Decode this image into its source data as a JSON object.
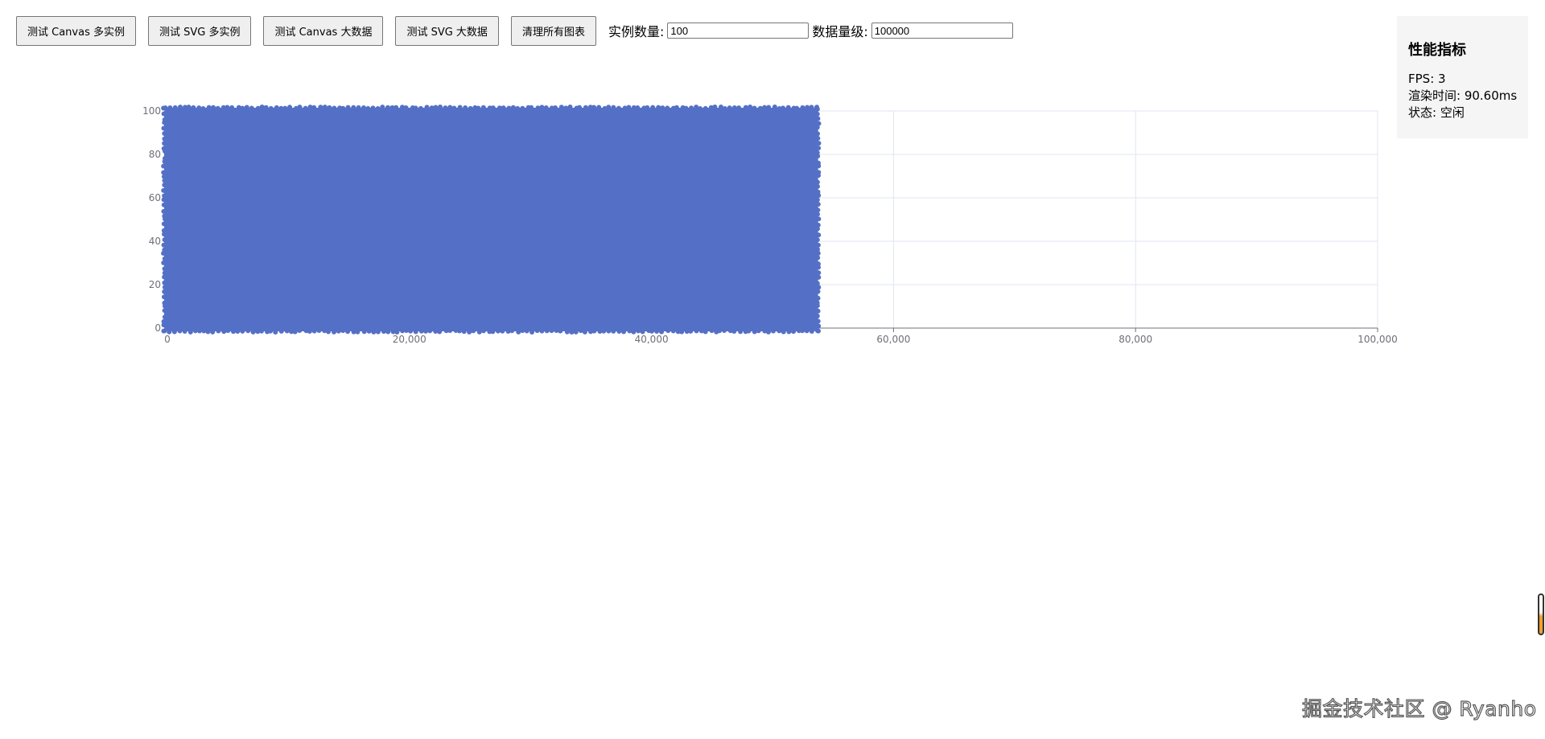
{
  "toolbar": {
    "buttons": [
      {
        "label": "测试 Canvas 多实例"
      },
      {
        "label": "测试 SVG 多实例"
      },
      {
        "label": "测试 Canvas 大数据"
      },
      {
        "label": "测试 SVG 大数据"
      },
      {
        "label": "清理所有图表"
      }
    ],
    "instance_count_label": "实例数量:",
    "instance_count_value": "100",
    "data_size_label": "数据量级:",
    "data_size_value": "100000"
  },
  "metrics": {
    "title": "性能指标",
    "fps": "FPS: 3",
    "render_time": "渲染时间: 90.60ms",
    "status": "状态: 空闲"
  },
  "chart_data": {
    "type": "scatter",
    "title": "",
    "xlabel": "",
    "ylabel": "",
    "xlim": [
      0,
      100000
    ],
    "ylim": [
      0,
      100
    ],
    "x_ticks": [
      "0",
      "20,000",
      "40,000",
      "60,000",
      "80,000",
      "100,000"
    ],
    "y_ticks": [
      "0",
      "20",
      "40",
      "60",
      "80",
      "100"
    ],
    "grid": true,
    "series": [
      {
        "color": "#5470c6",
        "dense_region": {
          "x": [
            0,
            53500
          ],
          "y": [
            0,
            100
          ]
        }
      }
    ]
  },
  "watermark": "掘金技术社区 @ Ryanho",
  "colors": {
    "accent": "#5470c6",
    "panel_bg": "#f5f5f5",
    "grid": "#e0e6f1",
    "axis": "#6e7079"
  }
}
